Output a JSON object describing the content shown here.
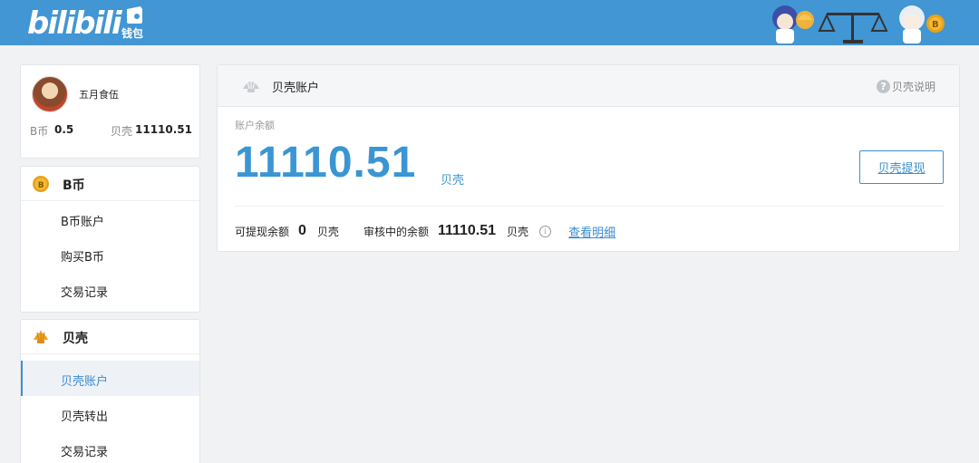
{
  "header": {
    "logo_text": "bilibili",
    "wallet_label": "钱包"
  },
  "user": {
    "name": "五月食伍",
    "bcoin_label": "B币",
    "bcoin_value": "0.5",
    "shell_label": "贝壳",
    "shell_value": "11110.51"
  },
  "sidebar": {
    "bcoin_section": {
      "title": "B币",
      "icon": "bcoin-icon",
      "items": [
        {
          "label": "B币账户"
        },
        {
          "label": "购买B币"
        },
        {
          "label": "交易记录"
        }
      ]
    },
    "shell_section": {
      "title": "贝壳",
      "icon": "shell-icon",
      "items": [
        {
          "label": "贝壳账户",
          "active": true
        },
        {
          "label": "贝壳转出"
        },
        {
          "label": "交易记录"
        }
      ]
    }
  },
  "main": {
    "title": "贝壳账户",
    "help_label": "贝壳说明",
    "balance_label": "账户余额",
    "balance_amount": "11110.51",
    "balance_unit": "贝壳",
    "withdraw_button": "贝壳提现",
    "withdrawable_label": "可提现余额",
    "withdrawable_value": "0",
    "withdrawable_unit": "贝壳",
    "pending_label": "审核中的余额",
    "pending_value": "11110.51",
    "pending_unit": "贝壳",
    "detail_link": "查看明细"
  },
  "colors": {
    "header_bg": "#4196d3",
    "accent": "#3a96d3",
    "page_bg": "#f1f2f4"
  }
}
